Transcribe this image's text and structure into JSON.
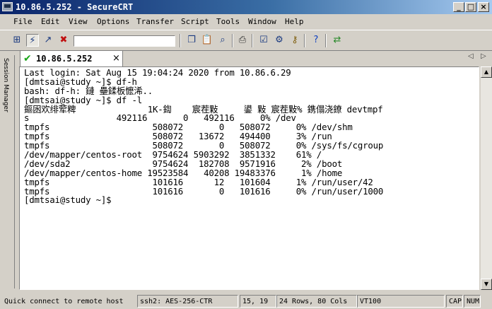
{
  "window": {
    "title": "10.86.5.252 - SecureCRT",
    "buttons": {
      "minimize": "_",
      "maximize": "□",
      "close": "×"
    }
  },
  "menu": [
    "File",
    "Edit",
    "View",
    "Options",
    "Transfer",
    "Script",
    "Tools",
    "Window",
    "Help"
  ],
  "toolbar": {
    "icons": [
      "connect-icon",
      "quick-connect-icon",
      "connect-tab-icon",
      "disconnect-icon",
      "copy-icon",
      "paste-icon",
      "find-icon",
      "print-icon",
      "session-options-icon",
      "global-options-icon",
      "keymap-icon",
      "help-icon",
      "sftp-icon"
    ],
    "host_input_value": ""
  },
  "session_manager": {
    "label": "Session Manager"
  },
  "tab": {
    "label": "10.86.5.252",
    "close": "×",
    "nav_left": "◁",
    "nav_right": "▷"
  },
  "terminal": {
    "lines": [
      "Last login: Sat Aug 15 19:04:24 2020 from 10.86.6.29",
      "[dmtsai@study ~]$ df-h",
      "bash: df-h: 鏈 壘鍒板懡浠..",
      "[dmtsai@study ~]$ df -l",
      "鏂囦欢绯荤粺              1K-鍧    宸茬敤     鍙 敤 宸茬敤% 鎸傝浇鐐 devtmpf",
      "s                 492116       0   492116     0% /dev",
      "tmpfs                    508072       0   508072     0% /dev/shm",
      "tmpfs                    508072   13672   494400     3% /run",
      "tmpfs                    508072       0   508072     0% /sys/fs/cgroup",
      "/dev/mapper/centos-root  9754624 5903292  3851332    61% /",
      "/dev/sda2                9754624  182708  9571916     2% /boot",
      "/dev/mapper/centos-home 19523584   40208 19483376     1% /home",
      "tmpfs                    101616      12   101604     1% /run/user/42",
      "tmpfs                    101616       0   101616     0% /run/user/1000",
      "[dmtsai@study ~]$"
    ]
  },
  "status": {
    "message": "Quick connect to remote host",
    "protocol": "ssh2: AES-256-CTR",
    "cursor": "15,  19",
    "size": "24 Rows, 80 Cols",
    "emulation": "VT100",
    "cap": "CAP",
    "num": "NUM"
  },
  "colors": {
    "title_gradient_start": "#0a246a",
    "title_gradient_end": "#a6caf0",
    "chrome": "#d4d0c8",
    "terminal_bg": "#ffffff",
    "terminal_fg": "#000000",
    "tab_check": "#1aa51a"
  }
}
